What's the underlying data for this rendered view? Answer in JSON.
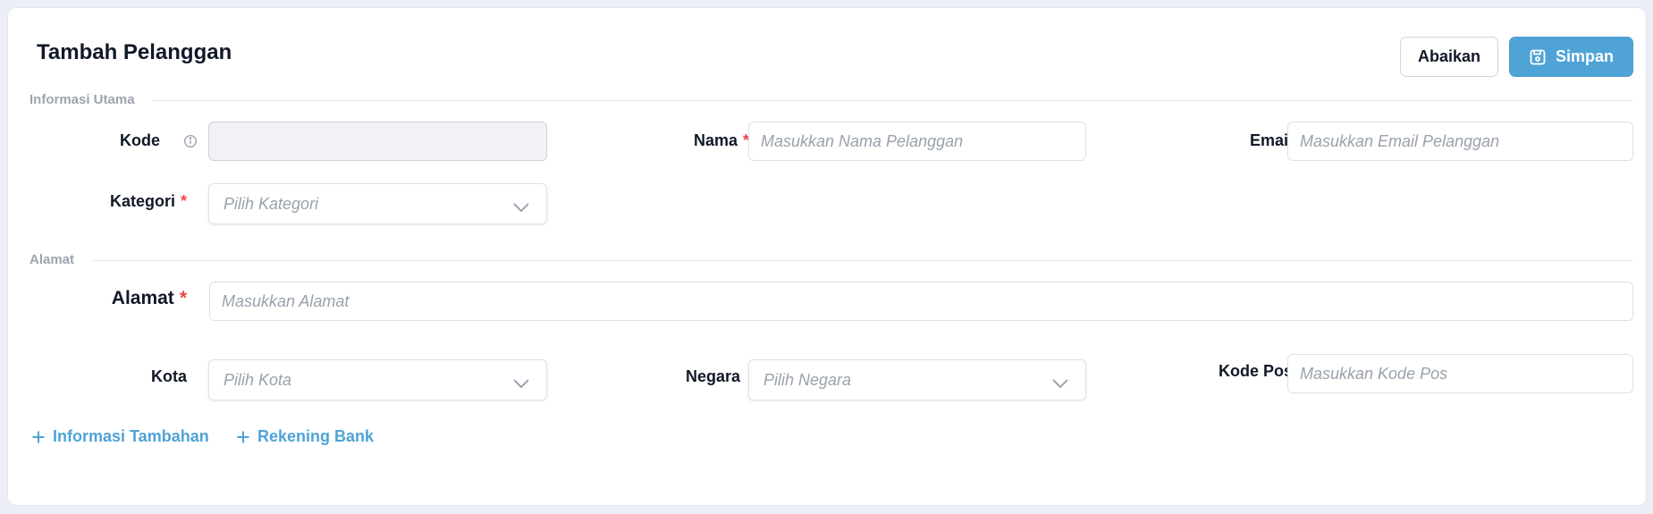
{
  "page": {
    "title": "Tambah Pelanggan"
  },
  "actions": {
    "cancel_label": "Abaikan",
    "save_label": "Simpan"
  },
  "sections": {
    "main": "Informasi Utama",
    "address": "Alamat"
  },
  "fields": {
    "kode": {
      "label": "Kode",
      "value": ""
    },
    "nama": {
      "label": "Nama",
      "placeholder": "Masukkan Nama Pelanggan"
    },
    "email": {
      "label": "Email",
      "placeholder": "Masukkan Email Pelanggan"
    },
    "kategori": {
      "label": "Kategori",
      "placeholder": "Pilih Kategori"
    },
    "alamat": {
      "label": "Alamat",
      "placeholder": "Masukkan Alamat"
    },
    "kota": {
      "label": "Kota",
      "placeholder": "Pilih Kota"
    },
    "negara": {
      "label": "Negara",
      "placeholder": "Pilih Negara"
    },
    "kode_pos": {
      "label": "Kode Pos",
      "placeholder": "Masukkan Kode Pos"
    }
  },
  "required_marker": "*",
  "links": {
    "additional_info": "Informasi Tambahan",
    "bank_account": "Rekening Bank"
  },
  "colors": {
    "accent": "#4fa3d6",
    "required": "#ef4444",
    "section_label": "#9ca3af"
  },
  "icons": {
    "save": "save-icon",
    "info": "info-icon",
    "chevron": "chevron-down-icon",
    "plus": "plus-icon"
  }
}
